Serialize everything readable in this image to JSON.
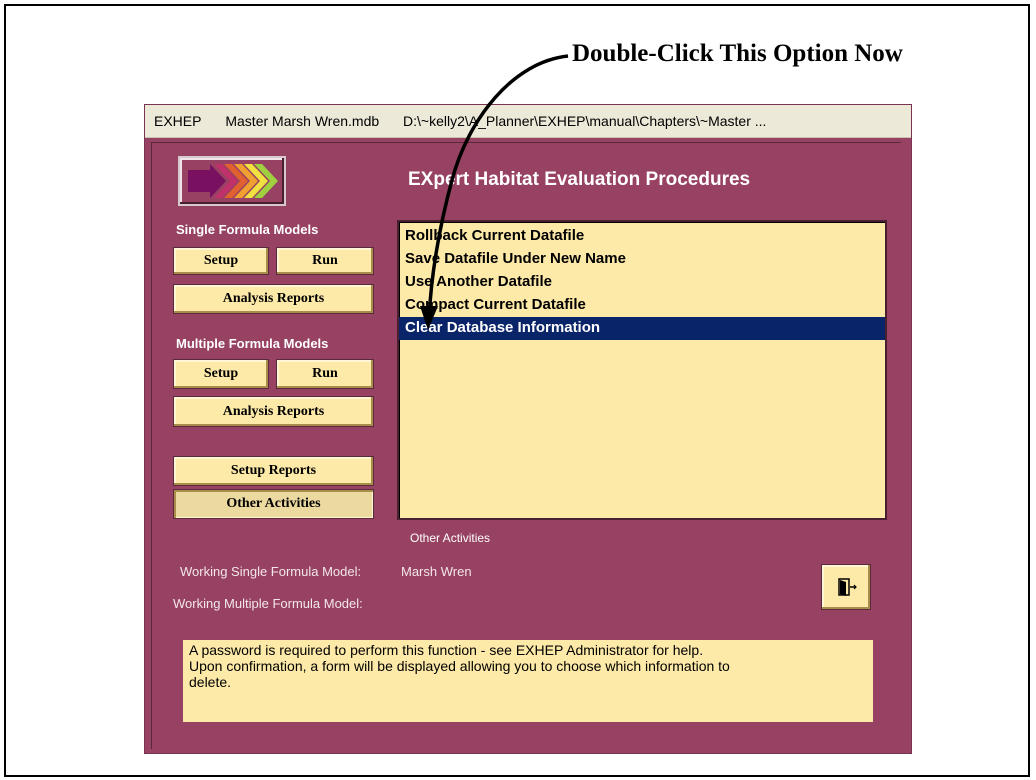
{
  "annotation": {
    "text": "Double-Click This Option Now"
  },
  "window": {
    "title_parts": [
      "EXHEP",
      "Master Marsh Wren.mdb",
      "D:\\~kelly2\\A_Planner\\EXHEP\\manual\\Chapters\\~Master ..."
    ]
  },
  "app_title": "EXpert Habitat Evaluation Procedures",
  "single": {
    "label": "Single Formula Models",
    "setup": "Setup",
    "run": "Run",
    "analysis": "Analysis Reports"
  },
  "multiple": {
    "label": "Multiple Formula Models",
    "setup": "Setup",
    "run": "Run",
    "analysis": "Analysis Reports"
  },
  "setup_reports": "Setup Reports",
  "other_activities": "Other Activities",
  "list": {
    "items": [
      "Rollback Current Datafile",
      "Save Datafile Under New Name",
      "Use Another Datafile",
      "Compact Current Datafile",
      "Clear Database Information"
    ],
    "selected_index": 4
  },
  "caption": "Other Activities",
  "working": {
    "single_label": "Working Single Formula Model:",
    "single_value": "Marsh Wren",
    "multiple_label": "Working Multiple Formula Model:",
    "multiple_value": ""
  },
  "exit_icon": "exit-door-icon",
  "message": {
    "lines": [
      "A password is required to perform this function - see EXHEP Administrator for help.",
      "Upon confirmation, a form will be displayed allowing you to choose which information to",
      "delete."
    ]
  },
  "colors": {
    "form_bg": "#974262",
    "button_bg": "#fde9a8",
    "selection": "#0a246a"
  }
}
